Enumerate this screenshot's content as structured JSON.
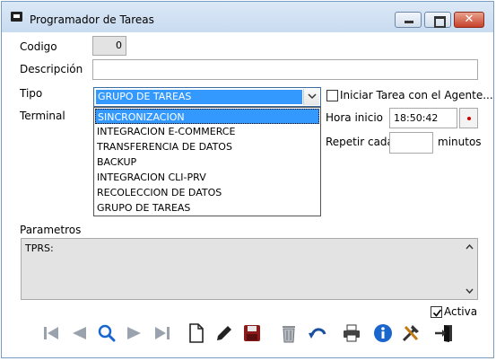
{
  "window": {
    "title": "Programador de Tareas"
  },
  "form": {
    "codigo_label": "Codigo",
    "codigo_value": "0",
    "descripcion_label": "Descripción",
    "descripcion_value": "",
    "tipo_label": "Tipo",
    "tipo_selected": "GRUPO DE TAREAS",
    "tipo_options": [
      "SINCRONIZACION",
      "INTEGRACION E-COMMERCE",
      "TRANSFERENCIA DE DATOS",
      "BACKUP",
      "INTEGRACION CLI-PRV",
      "RECOLECCION DE DATOS",
      "GRUPO DE TAREAS"
    ],
    "tipo_highlighted": "SINCRONIZACION",
    "terminal_label": "Terminal",
    "iniciar_label": "Iniciar Tarea con el Agente...",
    "iniciar_checked": false,
    "hora_inicio_label": "Hora inicio",
    "hora_inicio_value": "18:50:42",
    "repetir_label": "Repetir cada",
    "repetir_value": "",
    "minutos_label": "minutos",
    "parametros_label": "Parametros",
    "parametros_value": "TPRS:",
    "activa_label": "Activa",
    "activa_checked": true
  },
  "colors": {
    "selection": "#3399ff",
    "close_button": "#c8412a",
    "nav_icons": "#9aa3ad",
    "save_icon": "#8b1a1a",
    "info_icon": "#1a66cc"
  },
  "toolbar_icons": [
    "first-record-icon",
    "previous-record-icon",
    "search-icon",
    "next-record-icon",
    "last-record-icon",
    "new-document-icon",
    "edit-pencil-icon",
    "save-disk-icon",
    "delete-trash-icon",
    "undo-icon",
    "print-icon",
    "info-icon",
    "tools-icon",
    "exit-door-icon"
  ]
}
